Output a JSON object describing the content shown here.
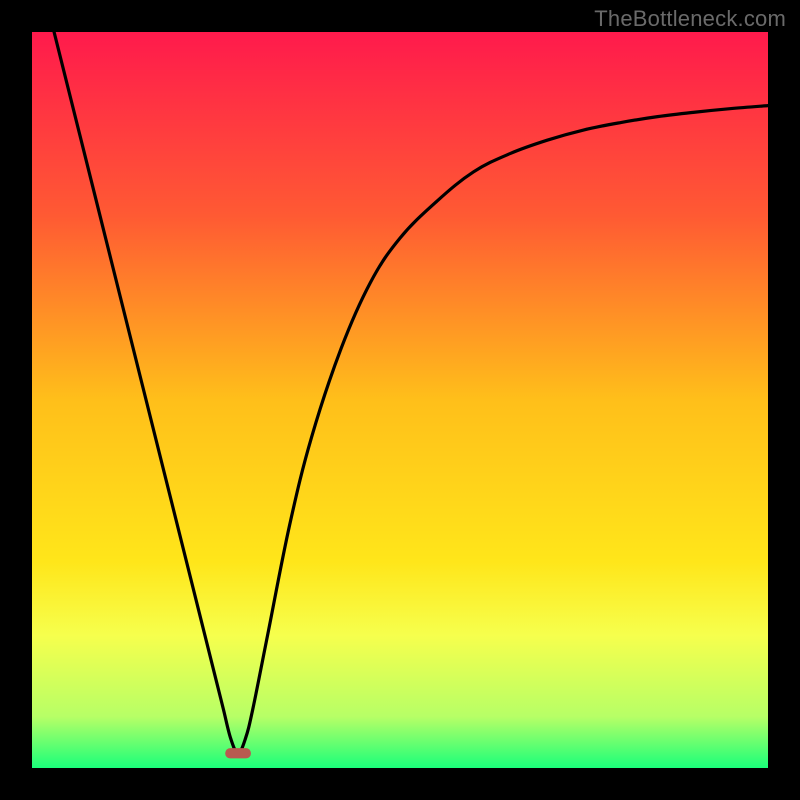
{
  "watermark": "TheBottleneck.com",
  "chart_data": {
    "type": "line",
    "title": "",
    "xlabel": "",
    "ylabel": "",
    "xlim": [
      0,
      100
    ],
    "ylim": [
      0,
      100
    ],
    "grid": false,
    "legend": false,
    "background_gradient": {
      "stops": [
        {
          "pos": 0.0,
          "color": "#ff1a4c"
        },
        {
          "pos": 0.25,
          "color": "#ff5a33"
        },
        {
          "pos": 0.5,
          "color": "#ffbf1a"
        },
        {
          "pos": 0.72,
          "color": "#ffe61a"
        },
        {
          "pos": 0.82,
          "color": "#f6ff4d"
        },
        {
          "pos": 0.93,
          "color": "#b7ff66"
        },
        {
          "pos": 1.0,
          "color": "#1aff7a"
        }
      ]
    },
    "series": [
      {
        "name": "bottleneck-curve",
        "color": "#000000",
        "x": [
          3,
          5,
          8,
          10,
          12,
          15,
          18,
          20,
          23,
          25,
          26,
          27,
          28,
          29,
          30,
          32,
          35,
          38,
          42,
          46,
          50,
          55,
          60,
          65,
          70,
          75,
          80,
          85,
          90,
          95,
          100
        ],
        "y": [
          100,
          92,
          80,
          72,
          64,
          52,
          40,
          32,
          20,
          12,
          8,
          4,
          2,
          4,
          8,
          18,
          33,
          45,
          57,
          66,
          72,
          77,
          81,
          83.5,
          85.3,
          86.7,
          87.7,
          88.5,
          89.1,
          89.6,
          90
        ]
      }
    ],
    "marker": {
      "name": "minimum-marker",
      "x": 28,
      "y": 2,
      "color": "#b85a50",
      "width": 3.5,
      "height": 1.4
    }
  }
}
